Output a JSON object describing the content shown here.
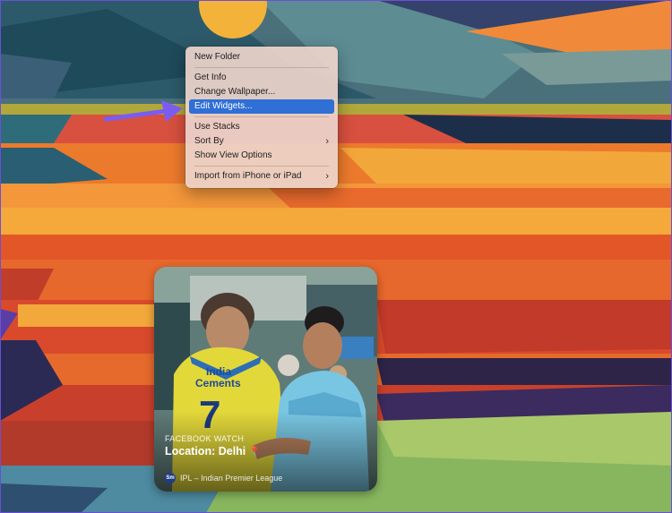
{
  "context_menu": {
    "items": [
      {
        "label": "New Folder"
      },
      {
        "label": "Get Info"
      },
      {
        "label": "Change Wallpaper..."
      },
      {
        "label": "Edit Widgets...",
        "state": "highlighted"
      },
      {
        "label": "Use Stacks"
      },
      {
        "label": "Sort By",
        "submenu": true
      },
      {
        "label": "Show View Options"
      },
      {
        "label": "Import from iPhone or iPad",
        "submenu": true
      }
    ]
  },
  "widget": {
    "source": "FACEBOOK WATCH",
    "title": "Location: Delhi",
    "title_icon": "pin-icon",
    "footer_badge": "Sm",
    "footer_text": "IPL – Indian Premier League",
    "jersey_text_1": "India",
    "jersey_text_2": "Cements",
    "jersey_number": "7"
  },
  "colors": {
    "menu_highlight": "#2f6fd6",
    "annotation_arrow": "#7b5cf0"
  }
}
